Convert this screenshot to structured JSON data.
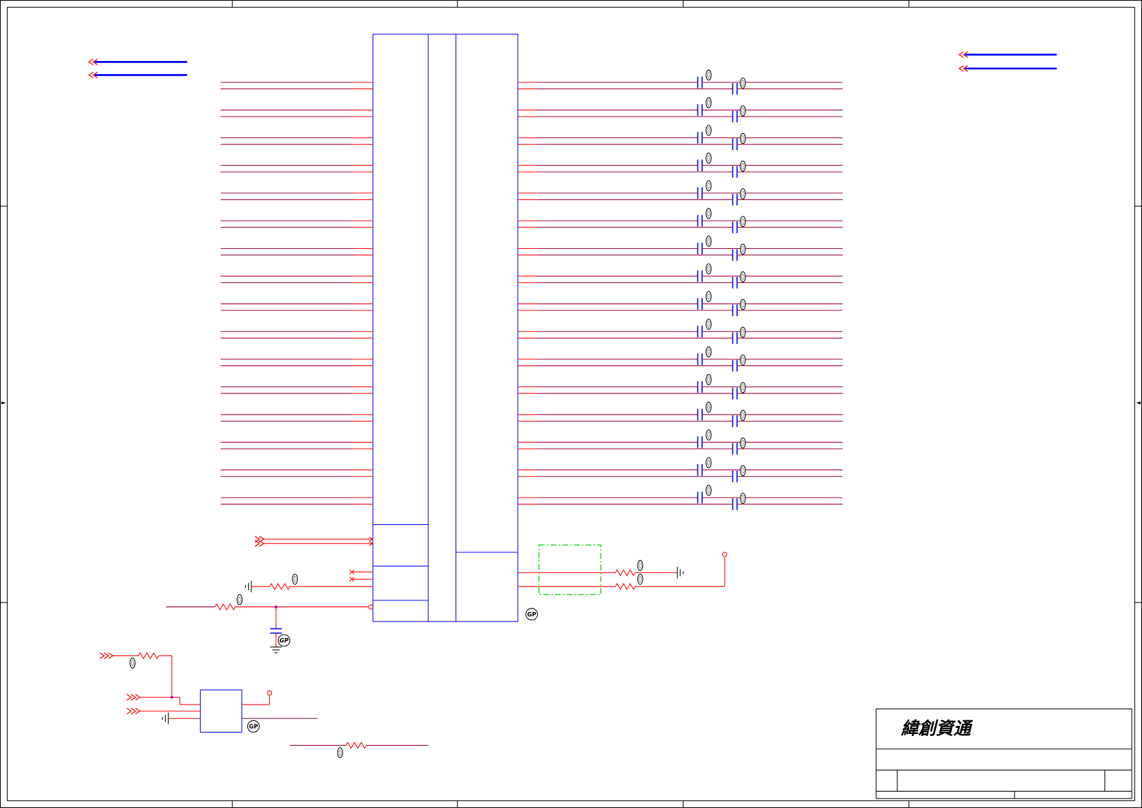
{
  "title_block": {
    "company": "緯創資通"
  },
  "badge_label": "GP",
  "colors": {
    "net": "#990033",
    "pin": "#ff0000",
    "body": "#0000ff",
    "bus": "#0000ff",
    "placeholder_box": "#00cc00",
    "junction": "#cc00cc"
  }
}
